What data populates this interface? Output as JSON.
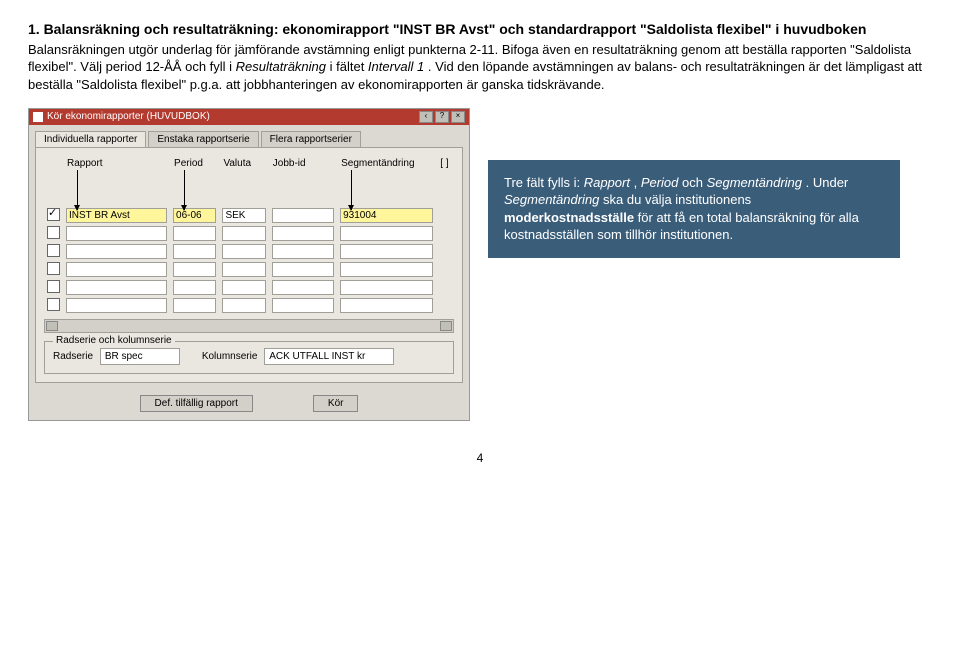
{
  "heading_part1": "1. Balansräkning och resultaträkning: ekonomirapport \"INST BR Avst\" och standardrapport \"Saldolista flexibel\" i huvudboken",
  "paragraph_1": "Balansräkningen utgör underlag för jämförande avstämning enligt punkterna 2-11. Bifoga även en resultaträkning genom att beställa rapporten \"Saldolista flexibel\". Välj period 12-ÅÅ och fyll i ",
  "paragraph_1_italic1": "Resultaträkning",
  "paragraph_1_mid": " i fältet ",
  "paragraph_1_italic2": "Intervall 1",
  "paragraph_1_tail": ". Vid den löpande avstämningen av balans- och resultaträkningen är det lämpligast att beställa \"Saldolista flexibel\" p.g.a. att jobbhanteringen av ekonomirapporten är ganska tidskrävande.",
  "dialog": {
    "title": "Kör ekonomirapporter (HUVUDBOK)",
    "win_controls": [
      "‹",
      "?",
      "×"
    ],
    "tabs": [
      "Individuella rapporter",
      "Enstaka rapportserie",
      "Flera rapportserier"
    ],
    "cols": {
      "c0": "",
      "rapport": "Rapport",
      "period": "Period",
      "valuta": "Valuta",
      "jobbid": "Jobb-id",
      "segment": "Segmentändring",
      "scroll": "[ ]"
    },
    "row1": {
      "rapport": "INST BR Avst",
      "period": "06-06",
      "valuta": "SEK",
      "jobbid": "",
      "segment": "931004"
    },
    "subgroup_title": "Radserie och kolumnserie",
    "radserie_label": "Radserie",
    "radserie_value": "BR spec",
    "kolumnserie_label": "Kolumnserie",
    "kolumnserie_value": "ACK UTFALL INST kr",
    "btn_def": "Def. tilfällig rapport",
    "btn_kor": "Kör"
  },
  "callout": {
    "l1a": "Tre fält fylls i: ",
    "l1_i1": "Rapport",
    "l1b": ", ",
    "l1_i2": "Period",
    "l1c": " och ",
    "l2_i1": "Segmentändring",
    "l2a": ". Under ",
    "l2_i2": "Segmentändring",
    "l2b": " ska du välja institutionens ",
    "l2_bold": "moderkostnadsställe",
    "l2c": " för att få en total balansräkning för alla kostnadsställen som tillhör institutionen."
  },
  "page_number": "4"
}
